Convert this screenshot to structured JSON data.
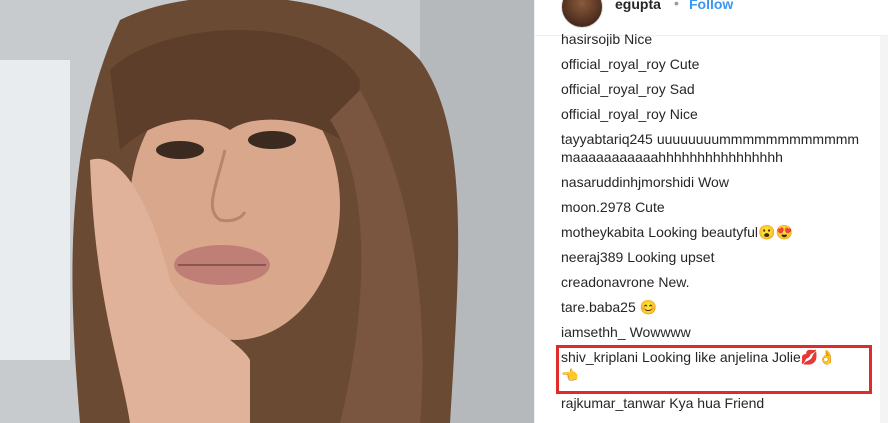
{
  "header": {
    "username": "egupta",
    "separator": "•",
    "follow_label": "Follow"
  },
  "comments": [
    {
      "user": "hasirsojib",
      "text": "Nice"
    },
    {
      "user": "official_royal_roy",
      "text": "Cute"
    },
    {
      "user": "official_royal_roy",
      "text": "Sad"
    },
    {
      "user": "official_royal_roy",
      "text": "Nice"
    },
    {
      "user": "tayyabtariq245",
      "text": "uuuuuuuummmmmmmmmmmmmaaaaaaaaaaahhhhhhhhhhhhhhhh"
    },
    {
      "user": "nasaruddinhjmorshidi",
      "text": "Wow"
    },
    {
      "user": "moon.2978",
      "text": "Cute"
    },
    {
      "user": "motheykabita",
      "text": "Looking beautyful😮😍"
    },
    {
      "user": "neeraj389",
      "text": "Looking upset"
    },
    {
      "user": "creadonavrone",
      "text": "New."
    },
    {
      "user": "tare.baba25",
      "text": "😊"
    },
    {
      "user": "iamsethh_",
      "text": "Wowwww"
    },
    {
      "user": "shiv_kriplani",
      "text": "Looking like anjelina Jolie💋👌👈"
    },
    {
      "user": "rajkumar_tanwar",
      "text": "Kya hua Friend"
    }
  ],
  "colors": {
    "highlight": "#e02b2b",
    "link": "#3897f0",
    "text": "#262626"
  }
}
